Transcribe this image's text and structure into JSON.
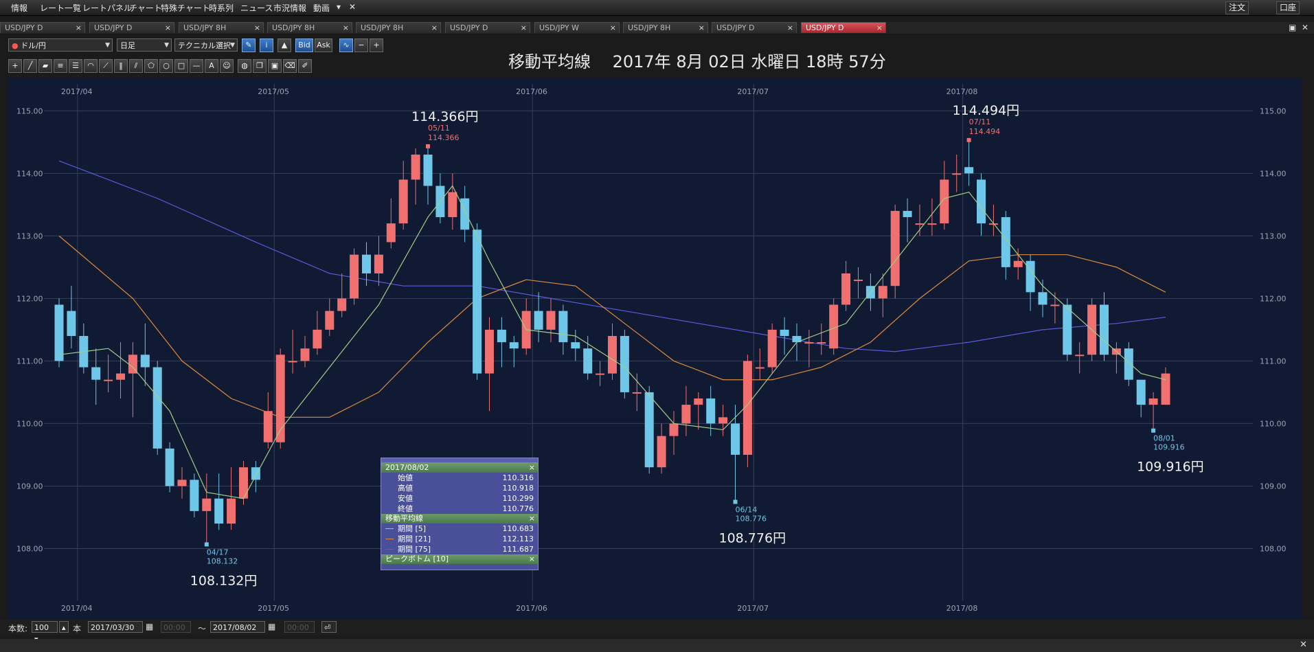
{
  "menubar": {
    "items": [
      "情報",
      "レート一覧",
      "レートパネル",
      "チャート",
      "特殊チャート",
      "時系列",
      "ニュース",
      "市況情報",
      "動画",
      "▾",
      "✕"
    ],
    "order_label": "注文",
    "account_label": "口座"
  },
  "tabs": [
    {
      "label": "USD/JPY D",
      "active": false
    },
    {
      "label": "USD/JPY D",
      "active": false
    },
    {
      "label": "USD/JPY 8H",
      "active": false
    },
    {
      "label": "USD/JPY 8H",
      "active": false
    },
    {
      "label": "USD/JPY 8H",
      "active": false
    },
    {
      "label": "USD/JPY D",
      "active": false
    },
    {
      "label": "USD/JPY W",
      "active": false
    },
    {
      "label": "USD/JPY 8H",
      "active": false
    },
    {
      "label": "USD/JPY D",
      "active": false
    },
    {
      "label": "USD/JPY D",
      "active": true
    }
  ],
  "toolbar": {
    "pair": "ドル/円",
    "timeframe": "日足",
    "technical": "テクニカル選択",
    "bid": "Bid",
    "ask": "Ask"
  },
  "chart_title": "移動平均線　 2017年 8月 02日 水曜日 18時 57分",
  "info_panel": {
    "date": "2017/08/02",
    "rows": [
      {
        "label": "始値",
        "value": "110.316"
      },
      {
        "label": "高値",
        "value": "110.918"
      },
      {
        "label": "安値",
        "value": "110.299"
      },
      {
        "label": "終値",
        "value": "110.776"
      }
    ],
    "ma_title": "移動平均線",
    "ma_rows": [
      {
        "label": "期間 [5]",
        "value": "110.683",
        "color": "#9fcf86"
      },
      {
        "label": "期間 [21]",
        "value": "112.113",
        "color": "#e08a3c"
      },
      {
        "label": "期間 [75]",
        "value": "111.687",
        "color": "#5a5ae0"
      }
    ],
    "peak_title": "ピークボトム [10]"
  },
  "statusbar": {
    "count_label": "本数:",
    "count_value": "100",
    "unit": "本",
    "from_date": "2017/03/30",
    "from_time": "00:00",
    "tilde": "〜",
    "to_date": "2017/08/02",
    "to_time": "00:00"
  },
  "chart_data": {
    "type": "candlestick",
    "title": "移動平均線",
    "ylim": [
      107.5,
      115.3
    ],
    "y_ticks": [
      "115.00",
      "114.00",
      "113.00",
      "112.00",
      "111.00",
      "110.00",
      "109.00",
      "108.00"
    ],
    "x_month_labels": [
      "2017/04",
      "2017/05",
      "2017/06",
      "2017/07",
      "2017/08"
    ],
    "up_color": "#f07070",
    "down_color": "#6ec6e8",
    "annotations": [
      {
        "index": 12,
        "date": "04/17",
        "price": "108.132",
        "big": "108.132円",
        "pos": "below"
      },
      {
        "index": 30,
        "date": "05/11",
        "price": "114.366",
        "big": "114.366円",
        "pos": "above"
      },
      {
        "index": 55,
        "date": "06/14",
        "price": "108.776",
        "big": "108.776円",
        "pos": "below"
      },
      {
        "index": 74,
        "date": "07/11",
        "price": "114.494",
        "big": "114.494円",
        "pos": "above"
      },
      {
        "index": 89,
        "date": "08/01",
        "price": "109.916",
        "big": "109.916円",
        "pos": "below"
      }
    ],
    "candles": [
      [
        111.9,
        111.0,
        112.0,
        110.9
      ],
      [
        111.8,
        111.4,
        112.2,
        111.2
      ],
      [
        111.4,
        110.9,
        111.6,
        110.8
      ],
      [
        110.9,
        110.7,
        111.2,
        110.3
      ],
      [
        110.7,
        110.7,
        111.1,
        110.5
      ],
      [
        110.7,
        110.8,
        111.3,
        110.4
      ],
      [
        110.8,
        111.1,
        111.3,
        110.1
      ],
      [
        111.1,
        110.9,
        111.6,
        110.6
      ],
      [
        110.9,
        109.6,
        111.0,
        109.5
      ],
      [
        109.6,
        109.0,
        109.7,
        108.9
      ],
      [
        109.0,
        109.1,
        109.3,
        108.8
      ],
      [
        109.1,
        108.6,
        109.2,
        108.5
      ],
      [
        108.6,
        108.8,
        109.2,
        108.1
      ],
      [
        108.8,
        108.4,
        109.2,
        108.3
      ],
      [
        108.4,
        108.8,
        109.3,
        108.3
      ],
      [
        108.8,
        109.3,
        109.4,
        108.7
      ],
      [
        109.3,
        109.1,
        109.4,
        108.9
      ],
      [
        109.7,
        110.2,
        110.5,
        109.6
      ],
      [
        109.7,
        111.1,
        111.2,
        109.6
      ],
      [
        111.0,
        111.0,
        111.5,
        110.8
      ],
      [
        111.0,
        111.2,
        111.4,
        110.9
      ],
      [
        111.2,
        111.5,
        111.8,
        111.1
      ],
      [
        111.5,
        111.8,
        112.0,
        111.4
      ],
      [
        111.8,
        112.0,
        112.4,
        111.7
      ],
      [
        112.0,
        112.7,
        112.8,
        111.9
      ],
      [
        112.7,
        112.4,
        112.9,
        112.2
      ],
      [
        112.4,
        112.7,
        113.0,
        112.2
      ],
      [
        112.9,
        113.2,
        113.6,
        112.8
      ],
      [
        113.2,
        113.9,
        114.2,
        113.1
      ],
      [
        113.9,
        114.3,
        114.4,
        113.5
      ],
      [
        114.3,
        113.8,
        114.4,
        113.5
      ],
      [
        113.8,
        113.3,
        114.0,
        113.2
      ],
      [
        113.3,
        113.7,
        114.0,
        113.1
      ],
      [
        113.6,
        113.1,
        113.8,
        112.9
      ],
      [
        113.1,
        110.8,
        113.2,
        110.7
      ],
      [
        110.8,
        111.5,
        111.7,
        110.2
      ],
      [
        111.5,
        111.3,
        111.7,
        110.9
      ],
      [
        111.3,
        111.2,
        111.4,
        110.9
      ],
      [
        111.2,
        111.8,
        112.0,
        111.1
      ],
      [
        111.8,
        111.5,
        112.1,
        111.3
      ],
      [
        111.5,
        111.8,
        112.0,
        111.3
      ],
      [
        111.8,
        111.3,
        111.9,
        111.1
      ],
      [
        111.3,
        111.2,
        111.5,
        111.0
      ],
      [
        111.2,
        110.8,
        111.4,
        110.7
      ],
      [
        110.8,
        110.8,
        111.0,
        110.6
      ],
      [
        110.8,
        111.4,
        111.6,
        110.7
      ],
      [
        111.4,
        110.5,
        111.5,
        110.4
      ],
      [
        110.5,
        110.5,
        110.8,
        110.2
      ],
      [
        110.5,
        109.3,
        110.6,
        109.2
      ],
      [
        109.3,
        109.8,
        110.0,
        109.2
      ],
      [
        109.8,
        110.0,
        110.2,
        109.5
      ],
      [
        110.0,
        110.3,
        110.6,
        109.8
      ],
      [
        110.3,
        110.4,
        110.5,
        109.9
      ],
      [
        110.4,
        110.0,
        110.6,
        109.8
      ],
      [
        110.0,
        110.1,
        110.3,
        109.8
      ],
      [
        110.0,
        109.5,
        110.3,
        108.78
      ],
      [
        109.5,
        111.0,
        111.1,
        109.3
      ],
      [
        110.9,
        110.9,
        111.2,
        110.7
      ],
      [
        110.9,
        111.5,
        111.6,
        110.8
      ],
      [
        111.5,
        111.4,
        111.7,
        111.1
      ],
      [
        111.4,
        111.3,
        111.6,
        111.0
      ],
      [
        111.3,
        111.3,
        111.5,
        110.9
      ],
      [
        111.3,
        111.3,
        111.6,
        111.1
      ],
      [
        111.2,
        111.9,
        112.0,
        111.1
      ],
      [
        111.9,
        112.4,
        112.6,
        111.8
      ],
      [
        112.3,
        112.3,
        112.5,
        112.0
      ],
      [
        112.2,
        112.0,
        112.4,
        111.8
      ],
      [
        112.0,
        112.2,
        112.4,
        111.7
      ],
      [
        112.2,
        113.4,
        113.5,
        112.0
      ],
      [
        113.4,
        113.3,
        113.6,
        112.9
      ],
      [
        113.2,
        113.2,
        113.5,
        113.0
      ],
      [
        113.2,
        113.2,
        113.6,
        113.0
      ],
      [
        113.2,
        113.9,
        114.2,
        113.1
      ],
      [
        114.0,
        114.0,
        114.3,
        113.7
      ],
      [
        114.1,
        114.0,
        114.5,
        113.8
      ],
      [
        113.9,
        113.2,
        114.0,
        113.0
      ],
      [
        113.2,
        113.2,
        113.5,
        113.0
      ],
      [
        113.3,
        112.5,
        113.4,
        112.3
      ],
      [
        112.5,
        112.6,
        112.8,
        112.3
      ],
      [
        112.6,
        112.1,
        112.7,
        111.8
      ],
      [
        112.1,
        111.9,
        112.3,
        111.7
      ],
      [
        111.9,
        111.9,
        112.1,
        111.6
      ],
      [
        111.9,
        111.1,
        112.0,
        111.0
      ],
      [
        111.1,
        111.1,
        111.3,
        110.8
      ],
      [
        111.1,
        111.9,
        112.0,
        111.0
      ],
      [
        111.9,
        111.1,
        112.1,
        111.0
      ],
      [
        111.1,
        111.2,
        111.3,
        110.8
      ],
      [
        111.2,
        110.7,
        111.3,
        110.6
      ],
      [
        110.7,
        110.3,
        110.7,
        110.1
      ],
      [
        110.3,
        110.4,
        110.5,
        109.92
      ],
      [
        110.3,
        110.8,
        110.9,
        110.3
      ]
    ],
    "ma_5_sample": [
      [
        0,
        111.1
      ],
      [
        4,
        111.2
      ],
      [
        6,
        110.9
      ],
      [
        9,
        110.2
      ],
      [
        12,
        108.9
      ],
      [
        15,
        108.8
      ],
      [
        18,
        109.9
      ],
      [
        22,
        110.9
      ],
      [
        26,
        111.9
      ],
      [
        30,
        113.3
      ],
      [
        32,
        113.8
      ],
      [
        35,
        112.6
      ],
      [
        38,
        111.5
      ],
      [
        42,
        111.4
      ],
      [
        46,
        110.9
      ],
      [
        50,
        110.0
      ],
      [
        54,
        109.9
      ],
      [
        56,
        110.3
      ],
      [
        60,
        111.3
      ],
      [
        64,
        111.6
      ],
      [
        68,
        112.6
      ],
      [
        72,
        113.6
      ],
      [
        74,
        113.7
      ],
      [
        76,
        113.2
      ],
      [
        80,
        112.2
      ],
      [
        84,
        111.5
      ],
      [
        88,
        110.8
      ],
      [
        90,
        110.7
      ]
    ],
    "ma_21_sample": [
      [
        0,
        113.0
      ],
      [
        6,
        112.0
      ],
      [
        10,
        111.0
      ],
      [
        14,
        110.4
      ],
      [
        18,
        110.1
      ],
      [
        22,
        110.1
      ],
      [
        26,
        110.5
      ],
      [
        30,
        111.3
      ],
      [
        34,
        112.0
      ],
      [
        38,
        112.3
      ],
      [
        42,
        112.2
      ],
      [
        46,
        111.6
      ],
      [
        50,
        111.0
      ],
      [
        54,
        110.7
      ],
      [
        58,
        110.7
      ],
      [
        62,
        110.9
      ],
      [
        66,
        111.3
      ],
      [
        70,
        112.0
      ],
      [
        74,
        112.6
      ],
      [
        78,
        112.7
      ],
      [
        82,
        112.7
      ],
      [
        86,
        112.5
      ],
      [
        90,
        112.1
      ]
    ],
    "ma_75_sample": [
      [
        0,
        114.2
      ],
      [
        8,
        113.6
      ],
      [
        16,
        112.9
      ],
      [
        22,
        112.4
      ],
      [
        28,
        112.2
      ],
      [
        34,
        112.2
      ],
      [
        40,
        112.0
      ],
      [
        46,
        111.8
      ],
      [
        52,
        111.6
      ],
      [
        58,
        111.4
      ],
      [
        64,
        111.2
      ],
      [
        68,
        111.15
      ],
      [
        74,
        111.3
      ],
      [
        80,
        111.5
      ],
      [
        86,
        111.6
      ],
      [
        90,
        111.7
      ]
    ]
  }
}
